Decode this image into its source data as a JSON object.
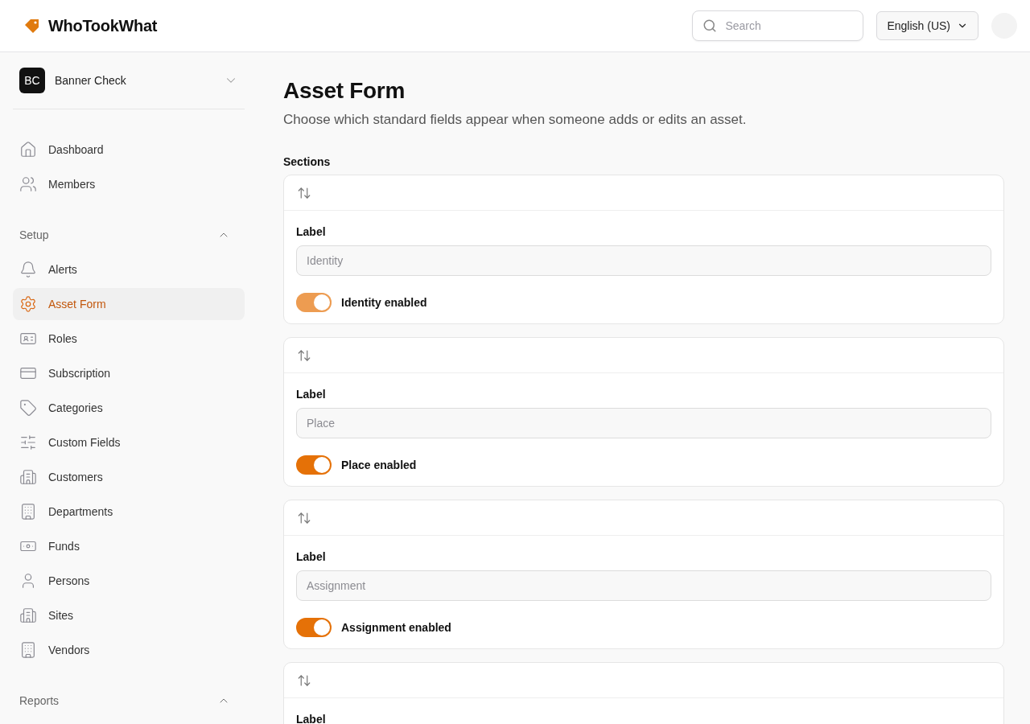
{
  "header": {
    "brand": "WhoTookWhat",
    "search": {
      "placeholder": "Search"
    },
    "language": "English (US)"
  },
  "sidebar": {
    "workspace": {
      "initials": "BC",
      "name": "Banner Check"
    },
    "items": [
      {
        "label": "Dashboard",
        "selected": false
      },
      {
        "label": "Members",
        "selected": false
      }
    ],
    "groups": [
      {
        "title": "Setup",
        "expanded": true,
        "items": [
          {
            "label": "Alerts",
            "selected": false
          },
          {
            "label": "Asset Form",
            "selected": true
          },
          {
            "label": "Roles",
            "selected": false
          },
          {
            "label": "Subscription",
            "selected": false
          },
          {
            "label": "Categories",
            "selected": false
          },
          {
            "label": "Custom Fields",
            "selected": false
          },
          {
            "label": "Customers",
            "selected": false
          },
          {
            "label": "Departments",
            "selected": false
          },
          {
            "label": "Funds",
            "selected": false
          },
          {
            "label": "Persons",
            "selected": false
          },
          {
            "label": "Sites",
            "selected": false
          },
          {
            "label": "Vendors",
            "selected": false
          }
        ]
      },
      {
        "title": "Reports",
        "expanded": true
      }
    ]
  },
  "page": {
    "title": "Asset Form",
    "subtitle": "Choose which standard fields appear when someone adds or edits an asset.",
    "sections_label": "Sections",
    "sections": [
      {
        "field_label": "Label",
        "placeholder": "Identity",
        "toggle_label": "Identity enabled",
        "on": true,
        "hovered": true
      },
      {
        "field_label": "Label",
        "placeholder": "Place",
        "toggle_label": "Place enabled",
        "on": true,
        "hovered": false
      },
      {
        "field_label": "Label",
        "placeholder": "Assignment",
        "toggle_label": "Assignment enabled",
        "on": true,
        "hovered": false
      },
      {
        "field_label": "Label"
      }
    ]
  }
}
